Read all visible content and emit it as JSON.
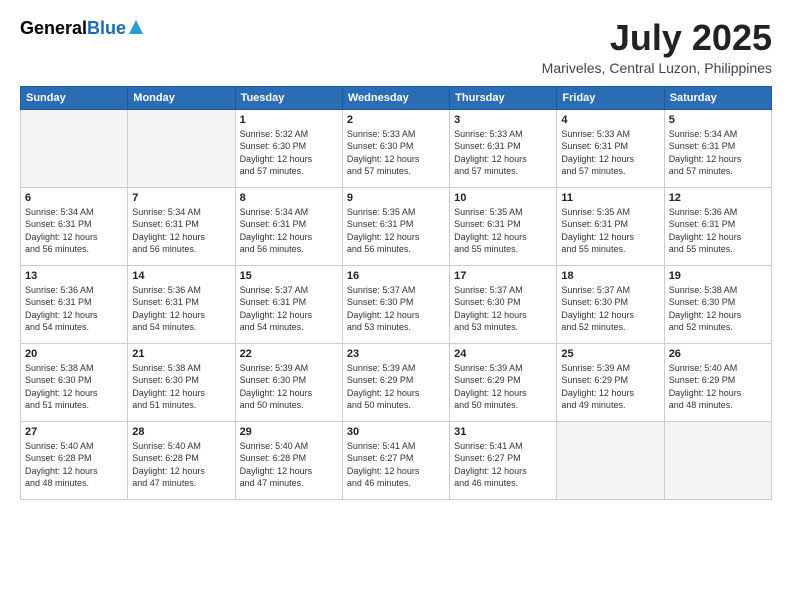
{
  "logo": {
    "general": "General",
    "blue": "Blue"
  },
  "title": {
    "month": "July 2025",
    "location": "Mariveles, Central Luzon, Philippines"
  },
  "days_of_week": [
    "Sunday",
    "Monday",
    "Tuesday",
    "Wednesday",
    "Thursday",
    "Friday",
    "Saturday"
  ],
  "weeks": [
    [
      {
        "day": "",
        "info": ""
      },
      {
        "day": "",
        "info": ""
      },
      {
        "day": "1",
        "info": "Sunrise: 5:32 AM\nSunset: 6:30 PM\nDaylight: 12 hours\nand 57 minutes."
      },
      {
        "day": "2",
        "info": "Sunrise: 5:33 AM\nSunset: 6:30 PM\nDaylight: 12 hours\nand 57 minutes."
      },
      {
        "day": "3",
        "info": "Sunrise: 5:33 AM\nSunset: 6:31 PM\nDaylight: 12 hours\nand 57 minutes."
      },
      {
        "day": "4",
        "info": "Sunrise: 5:33 AM\nSunset: 6:31 PM\nDaylight: 12 hours\nand 57 minutes."
      },
      {
        "day": "5",
        "info": "Sunrise: 5:34 AM\nSunset: 6:31 PM\nDaylight: 12 hours\nand 57 minutes."
      }
    ],
    [
      {
        "day": "6",
        "info": "Sunrise: 5:34 AM\nSunset: 6:31 PM\nDaylight: 12 hours\nand 56 minutes."
      },
      {
        "day": "7",
        "info": "Sunrise: 5:34 AM\nSunset: 6:31 PM\nDaylight: 12 hours\nand 56 minutes."
      },
      {
        "day": "8",
        "info": "Sunrise: 5:34 AM\nSunset: 6:31 PM\nDaylight: 12 hours\nand 56 minutes."
      },
      {
        "day": "9",
        "info": "Sunrise: 5:35 AM\nSunset: 6:31 PM\nDaylight: 12 hours\nand 56 minutes."
      },
      {
        "day": "10",
        "info": "Sunrise: 5:35 AM\nSunset: 6:31 PM\nDaylight: 12 hours\nand 55 minutes."
      },
      {
        "day": "11",
        "info": "Sunrise: 5:35 AM\nSunset: 6:31 PM\nDaylight: 12 hours\nand 55 minutes."
      },
      {
        "day": "12",
        "info": "Sunrise: 5:36 AM\nSunset: 6:31 PM\nDaylight: 12 hours\nand 55 minutes."
      }
    ],
    [
      {
        "day": "13",
        "info": "Sunrise: 5:36 AM\nSunset: 6:31 PM\nDaylight: 12 hours\nand 54 minutes."
      },
      {
        "day": "14",
        "info": "Sunrise: 5:36 AM\nSunset: 6:31 PM\nDaylight: 12 hours\nand 54 minutes."
      },
      {
        "day": "15",
        "info": "Sunrise: 5:37 AM\nSunset: 6:31 PM\nDaylight: 12 hours\nand 54 minutes."
      },
      {
        "day": "16",
        "info": "Sunrise: 5:37 AM\nSunset: 6:30 PM\nDaylight: 12 hours\nand 53 minutes."
      },
      {
        "day": "17",
        "info": "Sunrise: 5:37 AM\nSunset: 6:30 PM\nDaylight: 12 hours\nand 53 minutes."
      },
      {
        "day": "18",
        "info": "Sunrise: 5:37 AM\nSunset: 6:30 PM\nDaylight: 12 hours\nand 52 minutes."
      },
      {
        "day": "19",
        "info": "Sunrise: 5:38 AM\nSunset: 6:30 PM\nDaylight: 12 hours\nand 52 minutes."
      }
    ],
    [
      {
        "day": "20",
        "info": "Sunrise: 5:38 AM\nSunset: 6:30 PM\nDaylight: 12 hours\nand 51 minutes."
      },
      {
        "day": "21",
        "info": "Sunrise: 5:38 AM\nSunset: 6:30 PM\nDaylight: 12 hours\nand 51 minutes."
      },
      {
        "day": "22",
        "info": "Sunrise: 5:39 AM\nSunset: 6:30 PM\nDaylight: 12 hours\nand 50 minutes."
      },
      {
        "day": "23",
        "info": "Sunrise: 5:39 AM\nSunset: 6:29 PM\nDaylight: 12 hours\nand 50 minutes."
      },
      {
        "day": "24",
        "info": "Sunrise: 5:39 AM\nSunset: 6:29 PM\nDaylight: 12 hours\nand 50 minutes."
      },
      {
        "day": "25",
        "info": "Sunrise: 5:39 AM\nSunset: 6:29 PM\nDaylight: 12 hours\nand 49 minutes."
      },
      {
        "day": "26",
        "info": "Sunrise: 5:40 AM\nSunset: 6:29 PM\nDaylight: 12 hours\nand 48 minutes."
      }
    ],
    [
      {
        "day": "27",
        "info": "Sunrise: 5:40 AM\nSunset: 6:28 PM\nDaylight: 12 hours\nand 48 minutes."
      },
      {
        "day": "28",
        "info": "Sunrise: 5:40 AM\nSunset: 6:28 PM\nDaylight: 12 hours\nand 47 minutes."
      },
      {
        "day": "29",
        "info": "Sunrise: 5:40 AM\nSunset: 6:28 PM\nDaylight: 12 hours\nand 47 minutes."
      },
      {
        "day": "30",
        "info": "Sunrise: 5:41 AM\nSunset: 6:27 PM\nDaylight: 12 hours\nand 46 minutes."
      },
      {
        "day": "31",
        "info": "Sunrise: 5:41 AM\nSunset: 6:27 PM\nDaylight: 12 hours\nand 46 minutes."
      },
      {
        "day": "",
        "info": ""
      },
      {
        "day": "",
        "info": ""
      }
    ]
  ]
}
